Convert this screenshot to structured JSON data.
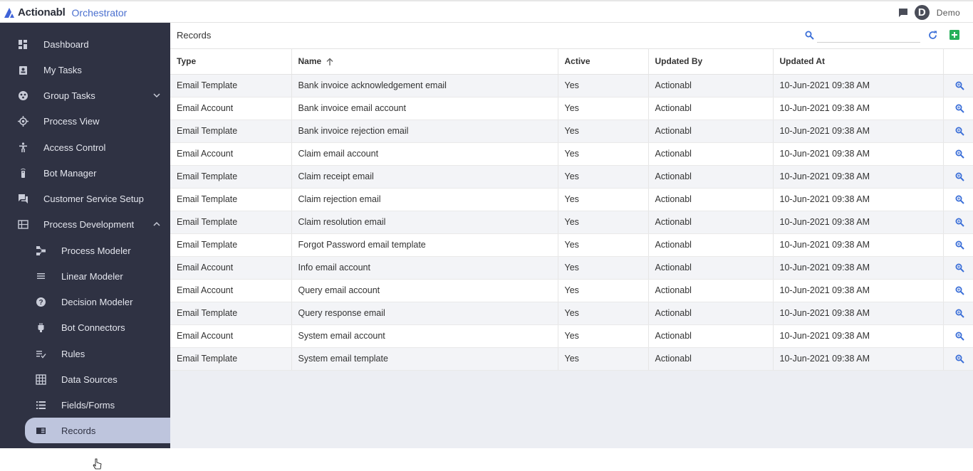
{
  "header": {
    "brand": "Actionabl",
    "product": "Orchestrator",
    "avatar_initial": "D",
    "user": "Demo"
  },
  "colors": {
    "sidebar_bg": "#2f3243",
    "active_item_bg": "#bec5dd",
    "accent_blue": "#4a6fcf",
    "add_green": "#27b05a"
  },
  "sidebar": {
    "items": [
      {
        "label": "Dashboard",
        "icon": "dashboard-icon"
      },
      {
        "label": "My Tasks",
        "icon": "task-icon"
      },
      {
        "label": "Group Tasks",
        "icon": "group-icon"
      },
      {
        "label": "Process View",
        "icon": "target-icon"
      },
      {
        "label": "Access Control",
        "icon": "person-icon"
      },
      {
        "label": "Bot Manager",
        "icon": "bot-icon"
      },
      {
        "label": "Customer Service Setup",
        "icon": "forum-icon"
      },
      {
        "label": "Process Development",
        "icon": "grid-icon"
      },
      {
        "label": "Process Modeler",
        "icon": "flow-icon"
      },
      {
        "label": "Linear Modeler",
        "icon": "lines-icon"
      },
      {
        "label": "Decision Modeler",
        "icon": "help-icon"
      },
      {
        "label": "Bot Connectors",
        "icon": "plug-icon"
      },
      {
        "label": "Rules",
        "icon": "rules-icon"
      },
      {
        "label": "Data Sources",
        "icon": "table-icon"
      },
      {
        "label": "Fields/Forms",
        "icon": "list-icon"
      },
      {
        "label": "Records",
        "icon": "book-icon"
      }
    ]
  },
  "main": {
    "title": "Records",
    "search": {
      "placeholder": "",
      "value": ""
    },
    "columns": [
      "Type",
      "Name",
      "Active",
      "Updated By",
      "Updated At"
    ],
    "rows": [
      {
        "type": "Email Template",
        "name": "Bank invoice acknowledgement email",
        "active": "Yes",
        "updated_by": "Actionabl",
        "updated_at": "10-Jun-2021 09:38 AM"
      },
      {
        "type": "Email Account",
        "name": "Bank invoice email account",
        "active": "Yes",
        "updated_by": "Actionabl",
        "updated_at": "10-Jun-2021 09:38 AM"
      },
      {
        "type": "Email Template",
        "name": "Bank invoice rejection email",
        "active": "Yes",
        "updated_by": "Actionabl",
        "updated_at": "10-Jun-2021 09:38 AM"
      },
      {
        "type": "Email Account",
        "name": "Claim email account",
        "active": "Yes",
        "updated_by": "Actionabl",
        "updated_at": "10-Jun-2021 09:38 AM"
      },
      {
        "type": "Email Template",
        "name": "Claim receipt email",
        "active": "Yes",
        "updated_by": "Actionabl",
        "updated_at": "10-Jun-2021 09:38 AM"
      },
      {
        "type": "Email Template",
        "name": "Claim rejection email",
        "active": "Yes",
        "updated_by": "Actionabl",
        "updated_at": "10-Jun-2021 09:38 AM"
      },
      {
        "type": "Email Template",
        "name": "Claim resolution email",
        "active": "Yes",
        "updated_by": "Actionabl",
        "updated_at": "10-Jun-2021 09:38 AM"
      },
      {
        "type": "Email Template",
        "name": "Forgot Password email template",
        "active": "Yes",
        "updated_by": "Actionabl",
        "updated_at": "10-Jun-2021 09:38 AM"
      },
      {
        "type": "Email Account",
        "name": "Info email account",
        "active": "Yes",
        "updated_by": "Actionabl",
        "updated_at": "10-Jun-2021 09:38 AM"
      },
      {
        "type": "Email Account",
        "name": "Query email account",
        "active": "Yes",
        "updated_by": "Actionabl",
        "updated_at": "10-Jun-2021 09:38 AM"
      },
      {
        "type": "Email Template",
        "name": "Query response email",
        "active": "Yes",
        "updated_by": "Actionabl",
        "updated_at": "10-Jun-2021 09:38 AM"
      },
      {
        "type": "Email Account",
        "name": "System email account",
        "active": "Yes",
        "updated_by": "Actionabl",
        "updated_at": "10-Jun-2021 09:38 AM"
      },
      {
        "type": "Email Template",
        "name": "System email template",
        "active": "Yes",
        "updated_by": "Actionabl",
        "updated_at": "10-Jun-2021 09:38 AM"
      }
    ]
  }
}
